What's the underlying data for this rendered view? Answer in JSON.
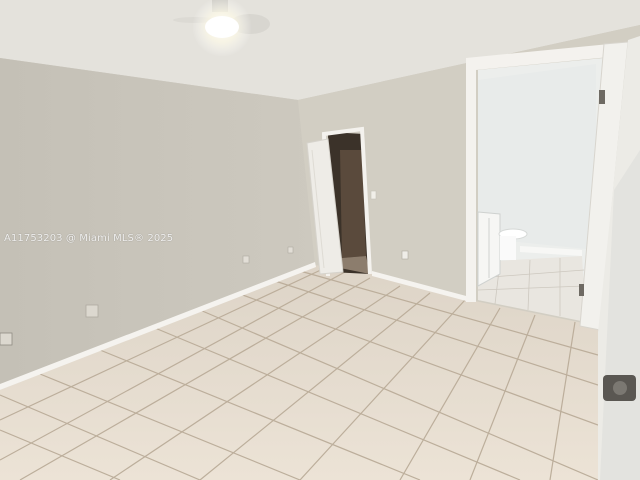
{
  "photo": {
    "scene": "empty bedroom with tile floor, open closet door and open bathroom doorway",
    "watermark_text": "A11753203 @ Miami MLS® 2025"
  },
  "colors": {
    "ceiling": "#e6e4df",
    "left_wall": "#c9c5bb",
    "back_wall": "#d3cfc4",
    "floor": "#e7ddd0",
    "grout": "#b9ab98",
    "trim": "#f4f2ee",
    "closet_dark": "#3a3128",
    "bath_wall": "#eef0ee"
  },
  "icons": {
    "ceiling_fan": "ceiling-fan-icon",
    "light": "light-fixture-icon"
  }
}
